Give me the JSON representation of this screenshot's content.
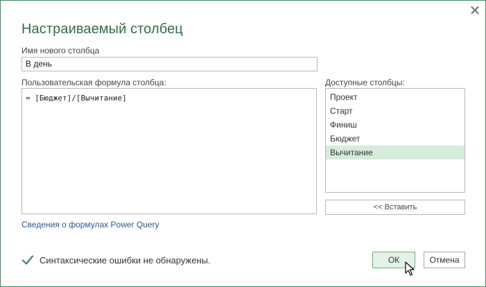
{
  "dialog": {
    "title": "Настраиваемый столбец",
    "close_glyph": "✕"
  },
  "name_field": {
    "label": "Имя нового столбца",
    "value": "В день"
  },
  "formula": {
    "label": "Пользовательская формула столбца:",
    "value": "= [Бюджет]/[Вычитание]"
  },
  "available_columns": {
    "label": "Доступные столбцы:",
    "items": [
      {
        "label": "Проект",
        "selected": false
      },
      {
        "label": "Старт",
        "selected": false
      },
      {
        "label": "Финиш",
        "selected": false
      },
      {
        "label": "Бюджет",
        "selected": false
      },
      {
        "label": "Вычитание",
        "selected": true
      }
    ],
    "insert_label": "<< Вставить"
  },
  "help_link": "Сведения о формулах Power Query",
  "status": {
    "icon": "checkmark-icon",
    "text": "Синтаксические ошибки не обнаружены."
  },
  "buttons": {
    "ok": "ОК",
    "cancel": "Отмена"
  },
  "colors": {
    "title": "#2f6e46",
    "accent_border": "#3c8a5a",
    "selected_row": "#d5ecdb",
    "check": "#3a8a52",
    "link": "#2b5797"
  }
}
